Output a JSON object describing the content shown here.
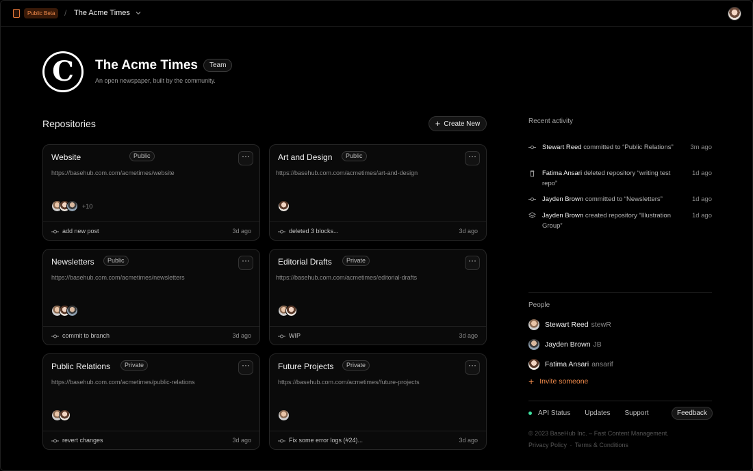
{
  "topbar": {
    "beta_label": "Public Beta",
    "separator": "/",
    "org_name": "The Acme Times"
  },
  "org": {
    "logo_letter": "C",
    "title": "The Acme Times",
    "team_badge": "Team",
    "description": "An open newspaper, built by the community."
  },
  "repos": {
    "title": "Repositories",
    "create_label": "Create New",
    "more_label": "···",
    "items": [
      {
        "name": "Website",
        "visibility": "Public",
        "url": "https://basehub.com.com/acmetimes/website",
        "extra_count": "+10",
        "commit": "add new post",
        "time": "3d ago"
      },
      {
        "name": "Art and Design",
        "visibility": "Public",
        "url": "https://basehub.com.com/acmetimes/art-and-design",
        "extra_count": "",
        "commit": "deleted 3 blocks...",
        "time": "3d ago"
      },
      {
        "name": "Newsletters",
        "visibility": "Public",
        "url": "https://basehub.com.com/acmetimes/newsletters",
        "extra_count": "",
        "commit": "commit to branch",
        "time": "3d ago"
      },
      {
        "name": "Editorial Drafts",
        "visibility": "Private",
        "url": "https://basehub.com.com/acmetimes/editorial-drafts",
        "extra_count": "",
        "commit": "WIP",
        "time": "3d ago"
      },
      {
        "name": "Public Relations",
        "visibility": "Private",
        "url": "https://basehub.com.com/acmetimes/public-relations",
        "extra_count": "",
        "commit": "revert changes",
        "time": "3d ago"
      },
      {
        "name": "Future Projects",
        "visibility": "Private",
        "url": "https://basehub.com.com/acmetimes/future-projects",
        "extra_count": "",
        "commit": "Fix some error logs (#24)...",
        "time": "3d ago"
      }
    ]
  },
  "activity": {
    "title": "Recent activity",
    "items": [
      {
        "icon": "commit-icon",
        "actor": "Stewart Reed",
        "action": " committed to “Public Relations”",
        "time": "3m ago"
      },
      {
        "icon": "trash-icon",
        "actor": "Fatima Ansari",
        "action": " deleted repository “writing test repo”",
        "time": "1d ago"
      },
      {
        "icon": "commit-icon",
        "actor": "Jayden Brown",
        "action": " committed to “Newsletters”",
        "time": "1d ago"
      },
      {
        "icon": "layers-icon",
        "actor": "Jayden Brown",
        "action": " created repository “Illustration Group”",
        "time": "1d ago"
      }
    ]
  },
  "people": {
    "title": "People",
    "items": [
      {
        "name": "Stewart Reed",
        "handle": "stewR"
      },
      {
        "name": "Jayden Brown",
        "handle": "JB"
      },
      {
        "name": "Fatima Ansari",
        "handle": "ansarif"
      }
    ],
    "invite_label": "Invite someone"
  },
  "footer": {
    "api_status": "API Status",
    "updates": "Updates",
    "support": "Support",
    "feedback": "Feedback",
    "copyright": "© 2023 BaseHub Inc. – Fast Content Management.",
    "privacy": "Privacy Policy",
    "legal_sep": "·",
    "terms": "Terms & Conditions"
  },
  "colors": {
    "accent": "#f08a4b",
    "status_ok": "#3ee0a0",
    "background": "#000000"
  }
}
